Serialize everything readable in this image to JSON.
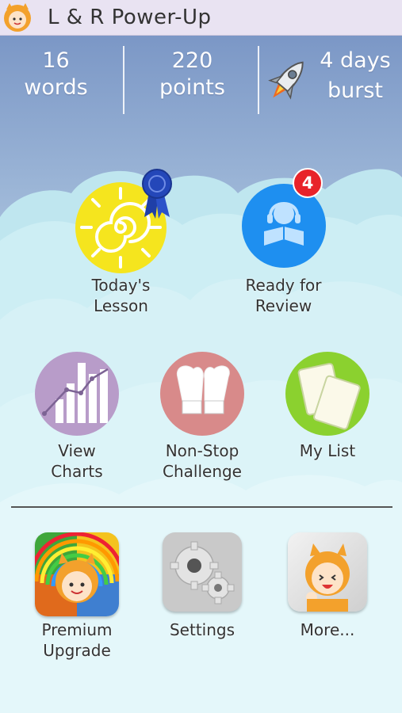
{
  "app": {
    "title": "L & R Power-Up"
  },
  "stats": {
    "words": {
      "value": "16",
      "unit": "words"
    },
    "points": {
      "value": "220",
      "unit": "points"
    },
    "burst": {
      "value": "4 days",
      "unit": "burst"
    }
  },
  "main_menu": {
    "todays_lesson": {
      "line1": "Today's",
      "line2": "Lesson"
    },
    "ready_for_review": {
      "line1": "Ready for",
      "line2": "Review",
      "badge": "4"
    },
    "view_charts": {
      "line1": "View",
      "line2": "Charts"
    },
    "non_stop_challenge": {
      "line1": "Non-Stop",
      "line2": "Challenge"
    },
    "my_list": {
      "line1": "My List"
    }
  },
  "bottom_menu": {
    "premium_upgrade": {
      "line1": "Premium",
      "line2": "Upgrade"
    },
    "settings": {
      "line1": "Settings"
    },
    "more": {
      "line1": "More..."
    }
  },
  "colors": {
    "sky_top": "#7b97c6",
    "sky_bottom": "#cfe3ee",
    "cloud": "#d7f2f7",
    "lesson_yellow": "#f5e51e",
    "review_blue": "#1e8ff0",
    "charts_purple": "#b89cc9",
    "challenge_pink": "#d88a8a",
    "mylist_green": "#8bd12f",
    "badge_red": "#e8232a"
  }
}
